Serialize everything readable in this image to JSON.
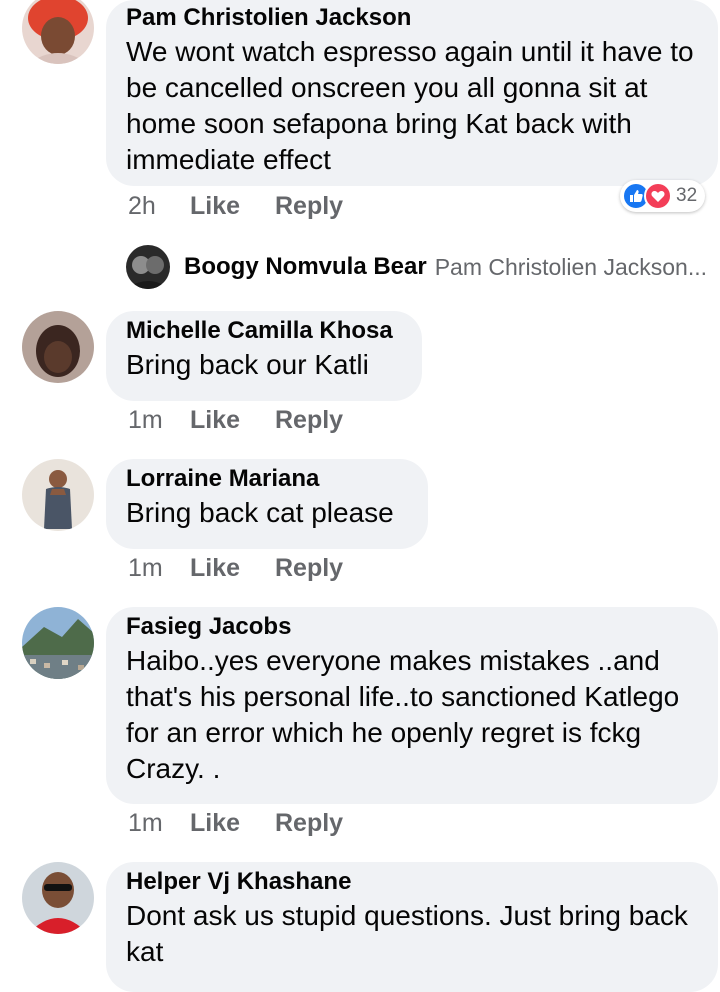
{
  "comments": [
    {
      "author": "Pam Christolien Jackson",
      "text": "We wont watch espresso again until it have to be cancelled onscreen you all gonna sit at home soon sefapona bring Kat back with immediate effect",
      "time": "2h",
      "like_label": "Like",
      "reply_label": "Reply",
      "reactions": {
        "count": "32",
        "types": [
          "like-icon",
          "love-icon"
        ]
      }
    },
    {
      "author": "Michelle Camilla Khosa",
      "text": "Bring back our Katli",
      "time": "1m",
      "like_label": "Like",
      "reply_label": "Reply"
    },
    {
      "author": "Lorraine Mariana",
      "text": "Bring back cat please",
      "time": "1m",
      "like_label": "Like",
      "reply_label": "Reply"
    },
    {
      "author": "Fasieg Jacobs",
      "text": "Haibo..yes everyone makes mistakes ..and that's his personal life..to sanctioned Katlego  for an error which he openly regret is fckg Crazy. .",
      "time": "1m",
      "like_label": "Like",
      "reply_label": "Reply"
    },
    {
      "author": "Helper Vj Khashane",
      "text": "Dont ask us stupid questions. Just bring back kat"
    }
  ],
  "reply_preview": {
    "author": "Boogy Nomvula Bear",
    "snippet": "Pam Christolien Jackson..."
  },
  "colors": {
    "bubble": "#f0f2f5",
    "meta_text": "#65676b",
    "like_blue": "#1877f2",
    "love_red": "#f33e58"
  }
}
